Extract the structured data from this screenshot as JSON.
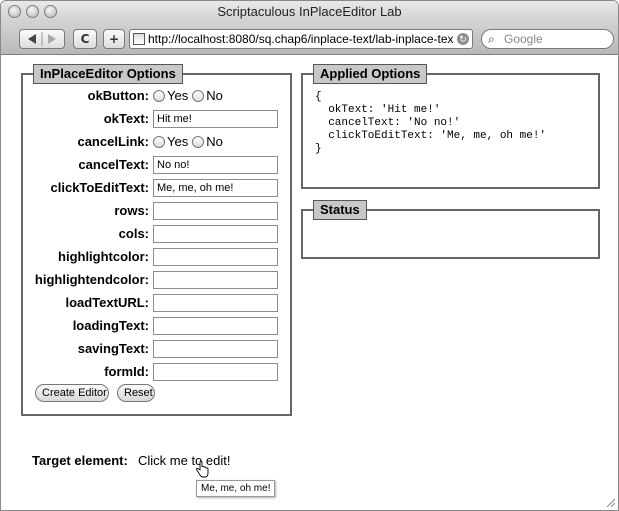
{
  "window": {
    "title": "Scriptaculous InPlaceEditor Lab"
  },
  "toolbar": {
    "back_icon": "back-arrow-icon",
    "forward_icon": "forward-arrow-icon",
    "reload_label": "C",
    "add_label": "+",
    "url": "http://localhost:8080/sq.chap6/inplace-text/lab-inplace-tex",
    "search_placeholder": "Google",
    "search_prefix": "Q"
  },
  "options_panel": {
    "legend": "InPlaceEditor Options",
    "rows": [
      {
        "label": "okButton:",
        "type": "radio",
        "options": [
          "Yes",
          "No"
        ]
      },
      {
        "label": "okText:",
        "type": "text",
        "value": "Hit me!"
      },
      {
        "label": "cancelLink:",
        "type": "radio",
        "options": [
          "Yes",
          "No"
        ]
      },
      {
        "label": "cancelText:",
        "type": "text",
        "value": "No no!"
      },
      {
        "label": "clickToEditText:",
        "type": "text",
        "value": "Me, me, oh me!"
      },
      {
        "label": "rows:",
        "type": "text",
        "value": ""
      },
      {
        "label": "cols:",
        "type": "text",
        "value": ""
      },
      {
        "label": "highlightcolor:",
        "type": "text",
        "value": ""
      },
      {
        "label": "highlightendcolor:",
        "type": "text",
        "value": ""
      },
      {
        "label": "loadTextURL:",
        "type": "text",
        "value": ""
      },
      {
        "label": "loadingText:",
        "type": "text",
        "value": ""
      },
      {
        "label": "savingText:",
        "type": "text",
        "value": ""
      },
      {
        "label": "formId:",
        "type": "text",
        "value": ""
      }
    ],
    "create_button": "Create Editor",
    "reset_button": "Reset"
  },
  "applied_panel": {
    "legend": "Applied Options",
    "code": "{\n  okText: 'Hit me!'\n  cancelText: 'No no!'\n  clickToEditText: 'Me, me, oh me!'\n}"
  },
  "status_panel": {
    "legend": "Status",
    "text": ""
  },
  "target": {
    "label": "Target element:",
    "text": "Click me to edit!",
    "tooltip": "Me, me, oh me!"
  }
}
